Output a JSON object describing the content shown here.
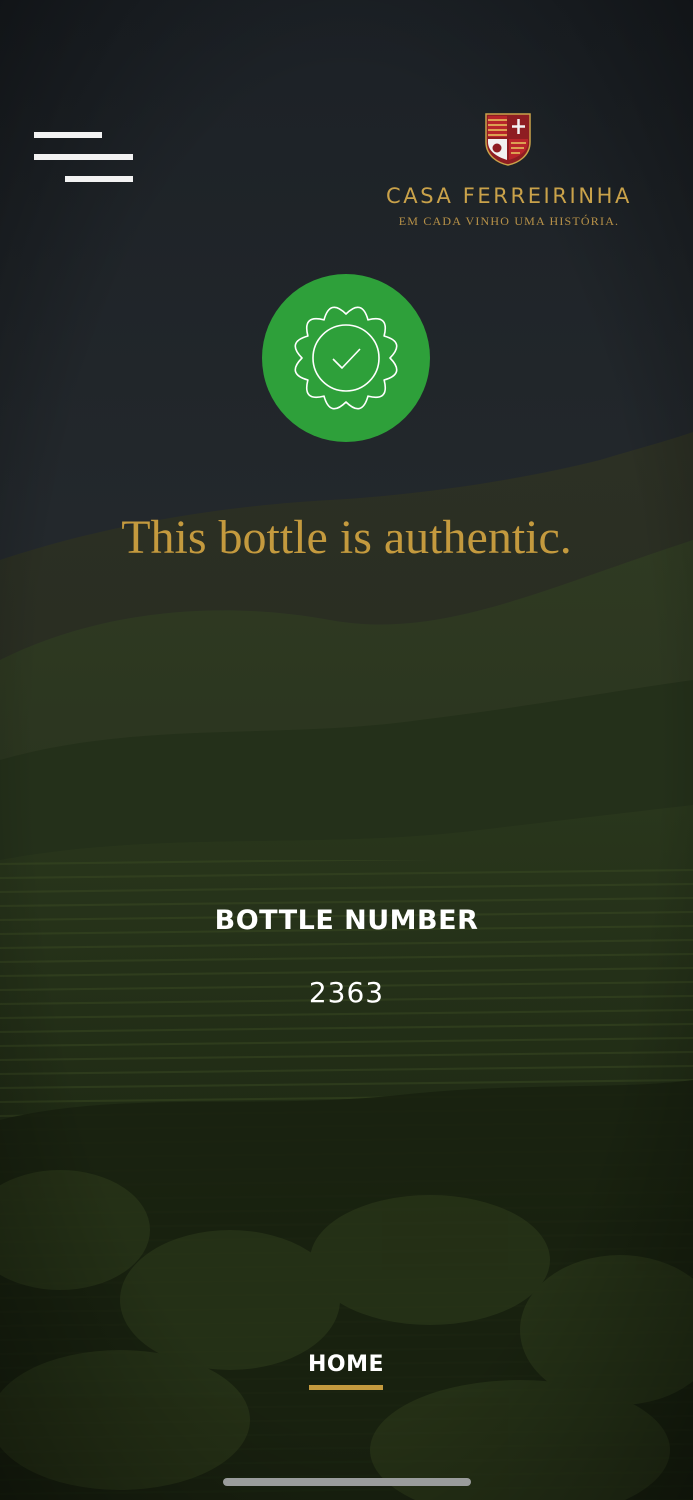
{
  "brand": {
    "name": "CASA FERREIRINHA",
    "tagline": "EM CADA VINHO UMA HISTÓRIA."
  },
  "icons": {
    "menu": "hamburger-menu-icon",
    "seal": "verified-seal-check-icon",
    "crest": "brand-crest-logo"
  },
  "verification": {
    "message": "This bottle is authentic."
  },
  "bottle": {
    "label": "BOTTLE NUMBER",
    "number": "2363"
  },
  "nav": {
    "home_label": "HOME"
  },
  "colors": {
    "accent_gold": "#c49a3e",
    "success_green": "#2ea03a",
    "text_white": "#ffffff"
  }
}
